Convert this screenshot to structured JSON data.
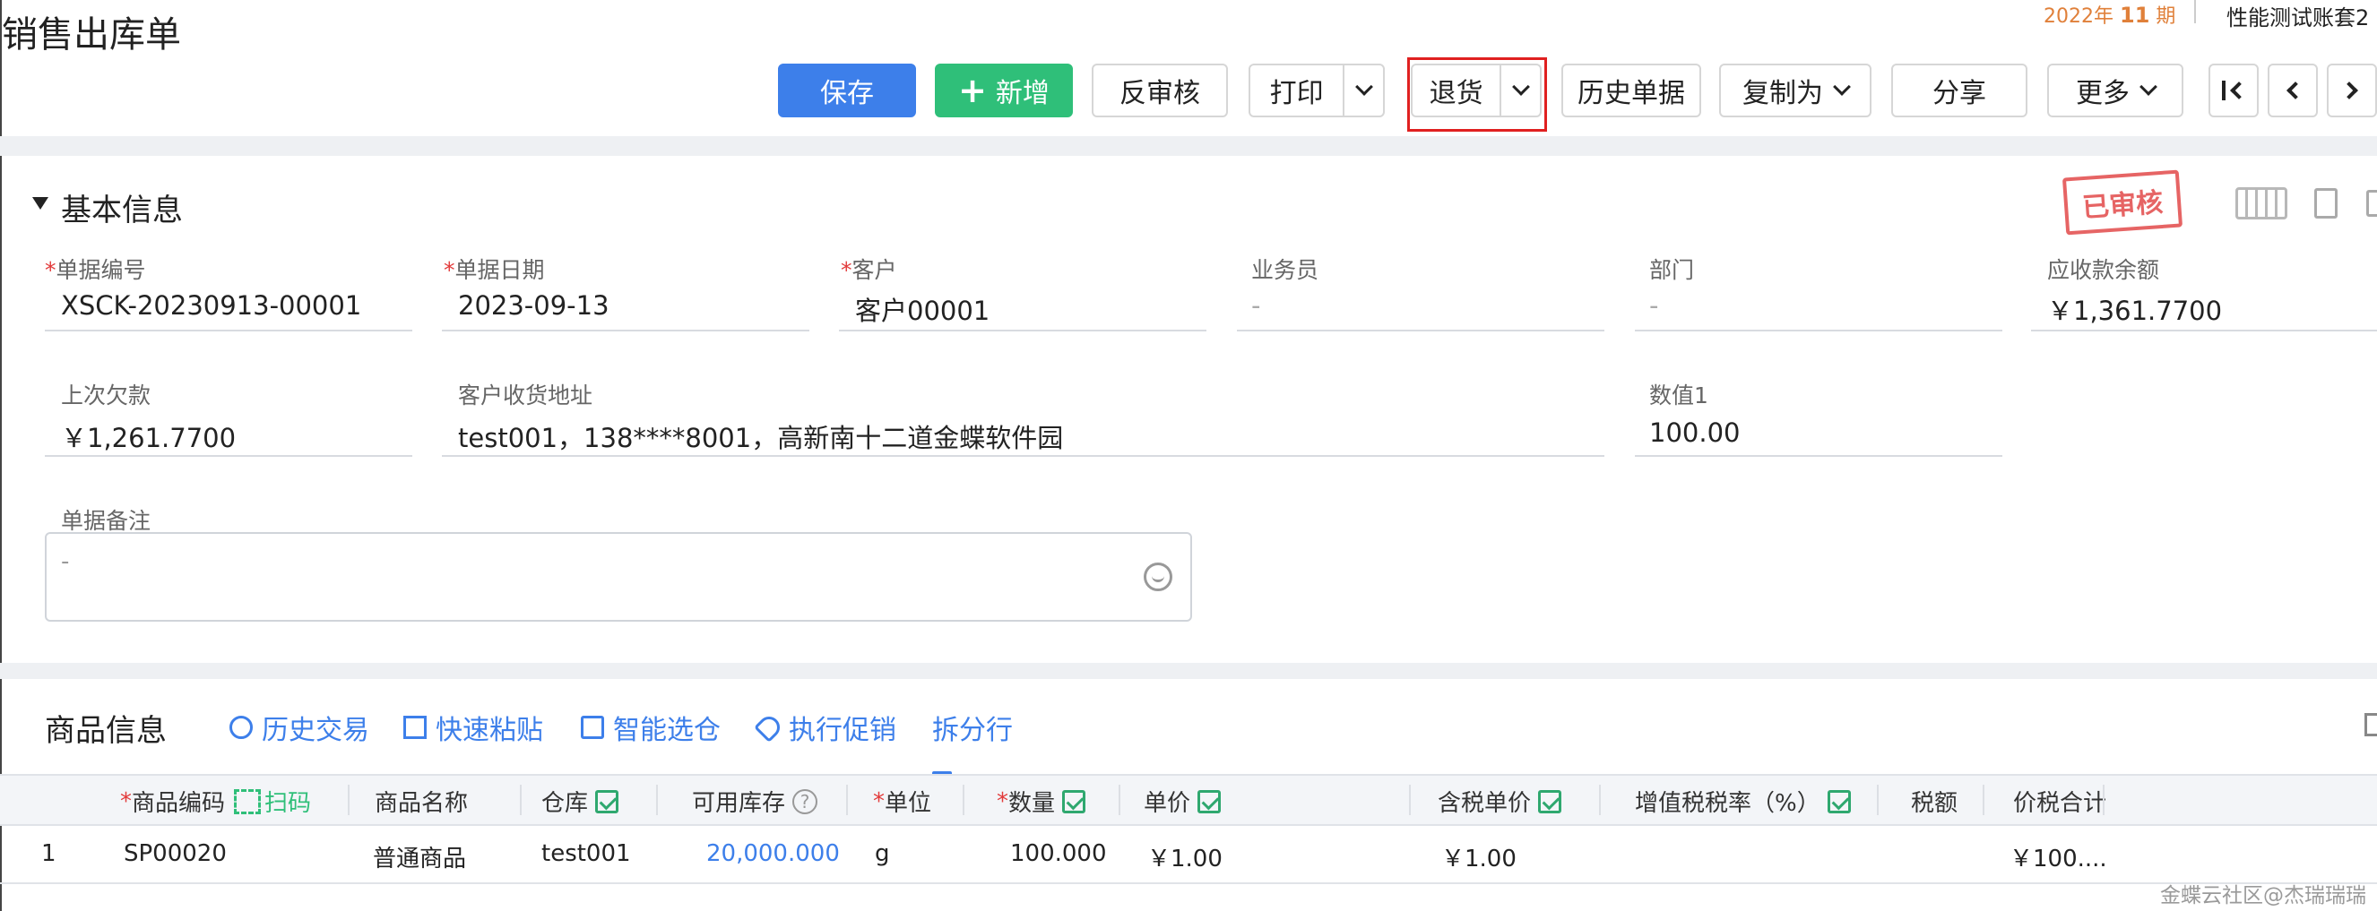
{
  "header": {
    "title": "销售出库单",
    "period_year": "2022年",
    "period_num": "11",
    "period_unit": "期",
    "account": "性能测试账套2"
  },
  "toolbar": {
    "save": "保存",
    "add": "新增",
    "unaudit": "反审核",
    "print": "打印",
    "return": "退货",
    "history": "历史单据",
    "copy_as": "复制为",
    "share": "分享",
    "more": "更多"
  },
  "basic": {
    "section_title": "基本信息",
    "stamp": "已审核",
    "fields": {
      "doc_no": {
        "label": "单据编号",
        "value": "XSCK-20230913-00001"
      },
      "doc_date": {
        "label": "单据日期",
        "value": "2023-09-13"
      },
      "customer": {
        "label": "客户",
        "value": "客户00001"
      },
      "salesman": {
        "label": "业务员",
        "value": "-"
      },
      "department": {
        "label": "部门",
        "value": "-"
      },
      "receivable": {
        "label": "应收款余额",
        "value": "￥1,361.7700"
      },
      "last_debt": {
        "label": "上次欠款",
        "value": "￥1,261.7700"
      },
      "address": {
        "label": "客户收货地址",
        "value": "test001，138****8001，高新南十二道金蝶软件园"
      },
      "num1": {
        "label": "数值1",
        "value": "100.00"
      },
      "remark": {
        "label": "单据备注",
        "value": "-"
      }
    }
  },
  "products": {
    "section_title": "商品信息",
    "tools": [
      "历史交易",
      "快速粘贴",
      "智能选仓",
      "执行促销",
      "拆分行"
    ],
    "scan": "扫码",
    "columns": {
      "code": "商品编码",
      "name": "商品名称",
      "warehouse": "仓库",
      "stock": "可用库存",
      "unit": "单位",
      "qty": "数量",
      "price": "单价",
      "tax_price": "含税单价",
      "vat_rate": "增值税税率（%）",
      "tax": "税额",
      "total": "价税合计"
    },
    "rows": [
      {
        "index": "1",
        "code": "SP00020",
        "name": "普通商品",
        "warehouse": "test001",
        "stock": "20,000.000",
        "unit": "g",
        "qty": "100.000",
        "price": "￥1.00",
        "tax_price": "￥1.00",
        "vat_rate": "",
        "tax": "",
        "total": "￥100...."
      }
    ]
  },
  "watermark": "金蝶云社区@杰瑞瑞瑞"
}
